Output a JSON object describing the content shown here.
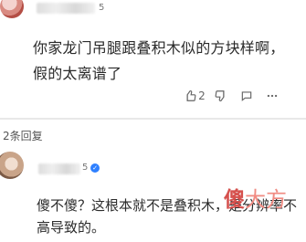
{
  "comment": {
    "level_badge": "5",
    "text": "你家龙门吊腿跟叠积木似的方块样啊，假的太离谱了",
    "actions": {
      "like_count": "2"
    }
  },
  "replies": {
    "count_label": "2条回复",
    "first": {
      "level_badge": "5",
      "text": "傻不傻？这根本就不是叠积木，是分辨率不高导致的。"
    }
  },
  "watermark": {
    "text_primary": "傻",
    "text_secondary": "大方"
  },
  "colors": {
    "background": "#ffffff",
    "divider": "#e8e8e8",
    "verify_badge": "#2f80ff",
    "watermark": "#d6504d"
  },
  "icons": {
    "like": "thumbs-up-icon",
    "dislike": "thumbs-down-icon",
    "comment": "comment-icon",
    "more": "more-icon",
    "verify": "verified-icon"
  }
}
